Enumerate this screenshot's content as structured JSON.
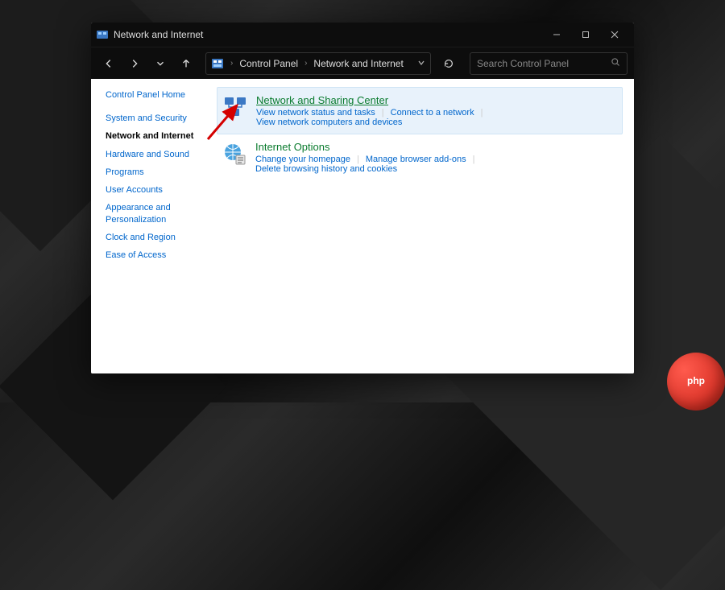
{
  "titlebar": {
    "title": "Network and Internet"
  },
  "address": {
    "crumb1": "Control Panel",
    "crumb2": "Network and Internet"
  },
  "search": {
    "placeholder": "Search Control Panel"
  },
  "sidebar": {
    "home": "Control Panel Home",
    "items": [
      {
        "label": "System and Security",
        "active": false
      },
      {
        "label": "Network and Internet",
        "active": true
      },
      {
        "label": "Hardware and Sound",
        "active": false
      },
      {
        "label": "Programs",
        "active": false
      },
      {
        "label": "User Accounts",
        "active": false
      },
      {
        "label": "Appearance and Personalization",
        "active": false
      },
      {
        "label": "Clock and Region",
        "active": false
      },
      {
        "label": "Ease of Access",
        "active": false
      }
    ]
  },
  "categories": [
    {
      "title": "Network and Sharing Center",
      "highlight": true,
      "underline": true,
      "links": [
        "View network status and tasks",
        "Connect to a network",
        "View network computers and devices"
      ]
    },
    {
      "title": "Internet Options",
      "highlight": false,
      "underline": false,
      "links": [
        "Change your homepage",
        "Manage browser add-ons",
        "Delete browsing history and cookies"
      ]
    }
  ],
  "watermark": "php"
}
